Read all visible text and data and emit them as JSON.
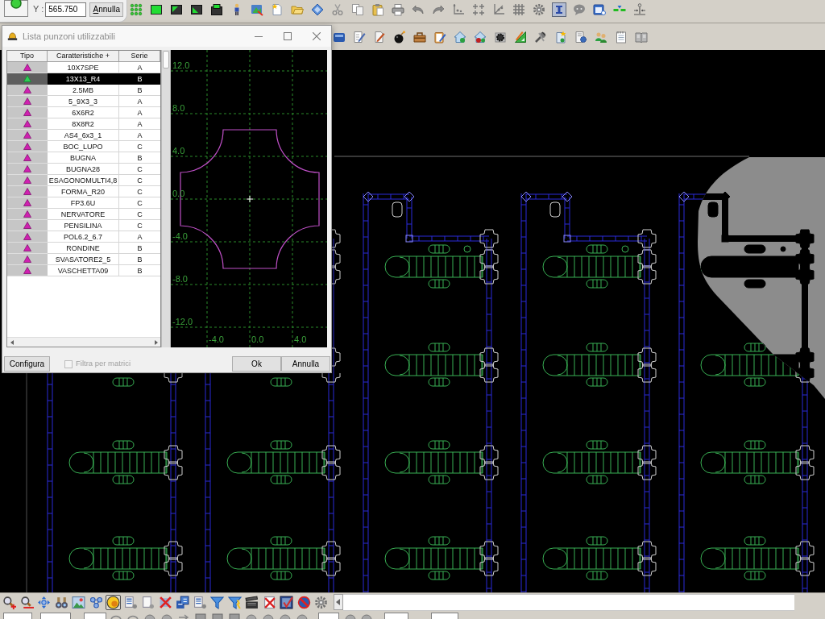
{
  "coordinate_panel": {
    "label": "Y :",
    "value": "565.750",
    "cancel_button": "Annulla"
  },
  "toolbar_row_1": [
    {
      "selected": false
    },
    {
      "selected": false
    },
    {
      "selected": false
    },
    {
      "selected": false
    },
    {
      "selected": false
    },
    {
      "selected": false
    },
    {
      "selected": false
    },
    {
      "selected": false
    },
    {
      "selected": false
    },
    {
      "selected": false
    },
    {
      "selected": false
    },
    {
      "selected": false
    },
    {
      "selected": false
    },
    {
      "selected": false
    },
    {
      "selected": false
    },
    {
      "selected": false
    },
    {
      "selected": false
    },
    {
      "selected": false
    },
    {
      "selected": false
    },
    {
      "selected": false
    },
    {
      "selected": false
    },
    {
      "selected": true
    },
    {
      "selected": false
    },
    {
      "selected": false
    },
    {
      "selected": false
    },
    {
      "selected": false
    }
  ],
  "dialog": {
    "title": "Lista punzoni utilizzabili",
    "columns": [
      "Tipo",
      "Caratteristiche +",
      "Serie"
    ],
    "rows": [
      {
        "name": "10X7SPE",
        "serie": "A",
        "selected": false
      },
      {
        "name": "13X13_R4",
        "serie": "B",
        "selected": true
      },
      {
        "name": "2.5MB",
        "serie": "B",
        "selected": false
      },
      {
        "name": "5_9X3_3",
        "serie": "A",
        "selected": false
      },
      {
        "name": "6X6R2",
        "serie": "A",
        "selected": false
      },
      {
        "name": "8X8R2",
        "serie": "A",
        "selected": false
      },
      {
        "name": "AS4_6x3_1",
        "serie": "A",
        "selected": false
      },
      {
        "name": "BOC_LUPO",
        "serie": "C",
        "selected": false
      },
      {
        "name": "BUGNA",
        "serie": "B",
        "selected": false
      },
      {
        "name": "BUGNA28",
        "serie": "C",
        "selected": false
      },
      {
        "name": "ESAGONOMULTI4,8",
        "serie": "C",
        "selected": false
      },
      {
        "name": "FORMA_R20",
        "serie": "C",
        "selected": false
      },
      {
        "name": "FP3.6U",
        "serie": "C",
        "selected": false
      },
      {
        "name": "NERVATORE",
        "serie": "C",
        "selected": false
      },
      {
        "name": "PENSILINA",
        "serie": "C",
        "selected": false
      },
      {
        "name": "POL6.2_6.7",
        "serie": "A",
        "selected": false
      },
      {
        "name": "RONDINE",
        "serie": "B",
        "selected": false
      },
      {
        "name": "SVASATORE2_5",
        "serie": "B",
        "selected": false
      },
      {
        "name": "VASCHETTA09",
        "serie": "B",
        "selected": false
      }
    ],
    "preview": {
      "y_labels": [
        "12.0",
        "8.0",
        "4.0",
        "0.0",
        "-4.0",
        "-8.0",
        "-12.0"
      ],
      "x_labels": [
        "-4.0",
        "0.0",
        "4.0"
      ]
    },
    "configure_button": "Configura",
    "filter": {
      "label": "Filtra per matrici",
      "checked": false,
      "disabled": true
    },
    "ok_button": "Ok",
    "cancel_button": "Annulla"
  },
  "bottom_toolbar": [
    {
      "selected": false
    },
    {
      "selected": false
    },
    {
      "selected": false
    },
    {
      "selected": false
    },
    {
      "selected": false
    },
    {
      "selected": false
    },
    {
      "selected": true
    },
    {
      "selected": false
    },
    {
      "selected": false
    },
    {
      "selected": false
    },
    {
      "selected": false
    },
    {
      "selected": false
    },
    {
      "selected": false
    },
    {
      "selected": false
    },
    {
      "selected": false
    },
    {
      "selected": false
    },
    {
      "selected": false
    },
    {
      "selected": false
    },
    {
      "selected": false
    }
  ]
}
